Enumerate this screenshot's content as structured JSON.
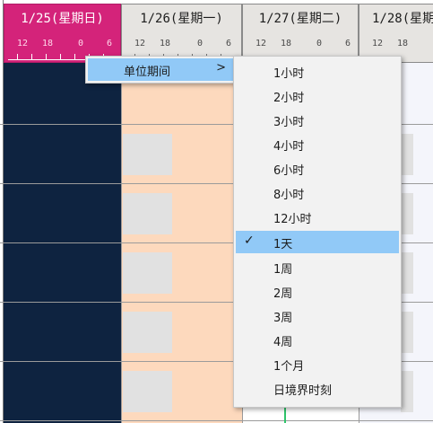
{
  "timeline": {
    "days": [
      {
        "label": "1/25(星期日)",
        "today": true
      },
      {
        "label": "1/26(星期一)",
        "today": false
      },
      {
        "label": "1/27(星期二)",
        "today": false
      },
      {
        "label": "1/28(星期",
        "today": false
      }
    ],
    "hours": [
      "12",
      "18",
      "0",
      "6"
    ]
  },
  "context_menu": {
    "item_label": "单位期间",
    "submenu_arrow": ">"
  },
  "submenu": {
    "items": [
      "1小时",
      "2小时",
      "3小时",
      "4小时",
      "6小时",
      "8小时",
      "12小时",
      "1天",
      "1周",
      "2周",
      "3周",
      "4周",
      "1个月",
      "日境界时刻"
    ],
    "selected_index": 7,
    "check_mark": "✓"
  }
}
